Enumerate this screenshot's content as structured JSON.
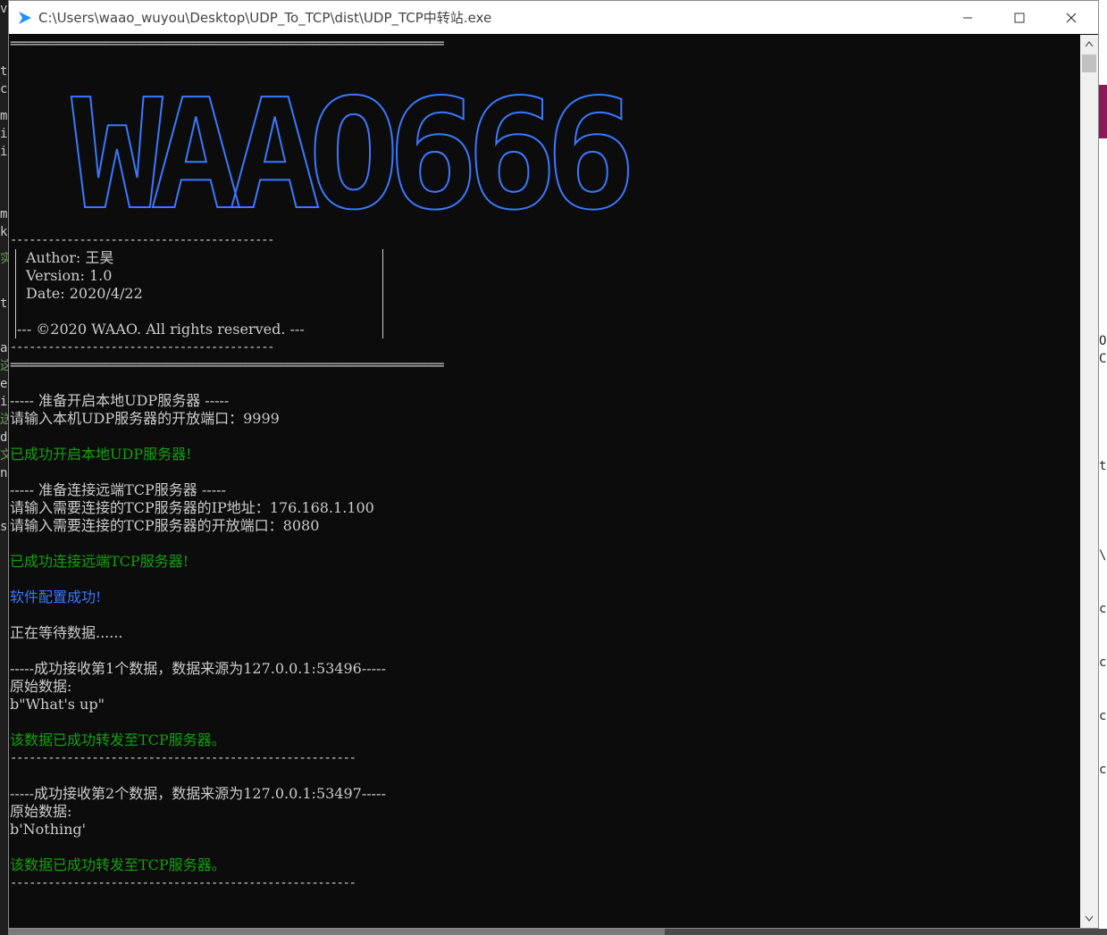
{
  "window": {
    "title": "C:\\Users\\waao_wuyou\\Desktop\\UDP_To_TCP\\dist\\UDP_TCP中转站.exe",
    "icon": "console-app-icon",
    "controls": [
      "minimize-icon",
      "maximize-icon",
      "close-icon"
    ]
  },
  "bg_left_chars": [
    "v",
    "t",
    "c",
    "m",
    "i",
    "i",
    "",
    "m",
    "k",
    "实",
    "t",
    "",
    "a",
    "这",
    "e",
    "i",
    "送",
    "d",
    "文",
    "n",
    "",
    "s"
  ],
  "bg_right_chars": [
    "O",
    "C",
    "t",
    "\\",
    "c",
    "c",
    "c",
    "c"
  ],
  "console": {
    "rule_top": "=====================================================================",
    "banner": "WAAO666",
    "box_rule_top": "------------------------------------------",
    "author": "Author: 王昊",
    "version": "Version: 1.0",
    "date": "Date: 2020/4/22",
    "copyright": "--- ©2020 WAAO. All rights reserved. ---",
    "box_rule_bottom": "------------------------------------------",
    "rule_bottom": "=====================================================================",
    "udp_header": "----- 准备开启本地UDP服务器 -----",
    "udp_prompt": "请输入本机UDP服务器的开放端口：9999",
    "udp_success": "已成功开启本地UDP服务器!",
    "tcp_header": "----- 准备连接远端TCP服务器 -----",
    "tcp_ip_prompt": "请输入需要连接的TCP服务器的IP地址：176.168.1.100",
    "tcp_port_prompt": "请输入需要连接的TCP服务器的开放端口：8080",
    "tcp_success": "已成功连接远端TCP服务器!",
    "config_success": "软件配置成功!",
    "waiting": "正在等待数据......",
    "messages": [
      {
        "header": "-----成功接收第1个数据，数据来源为127.0.0.1:53496-----",
        "raw_label": "原始数据:",
        "raw_value": "b\"What's up\"",
        "forwarded": "该数据已成功转发至TCP服务器。",
        "rule": "-------------------------------------------------------"
      },
      {
        "header": "-----成功接收第2个数据，数据来源为127.0.0.1:53497-----",
        "raw_label": "原始数据:",
        "raw_value": "b'Nothing'",
        "forwarded": "该数据已成功转发至TCP服务器。",
        "rule": "-------------------------------------------------------"
      }
    ]
  },
  "colors": {
    "console_bg": "#0c0c0c",
    "text": "#cccccc",
    "success_green": "#13a10e",
    "info_blue": "#3b78ff",
    "banner_blue": "#3b78ff"
  }
}
